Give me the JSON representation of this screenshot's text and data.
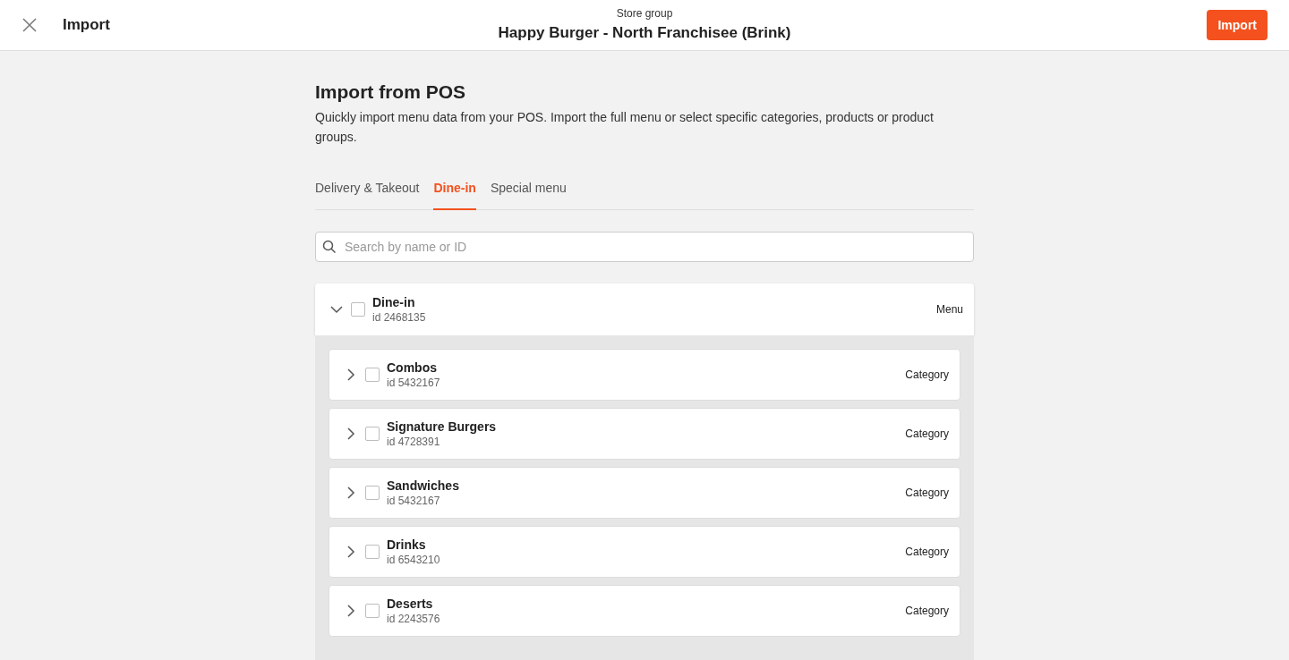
{
  "header": {
    "title": "Import",
    "subtitle": "Store group",
    "store": "Happy Burger - North Franchisee (Brink)",
    "import_button": "Import"
  },
  "page": {
    "title": "Import from POS",
    "description": "Quickly import menu data from your POS. Import the full menu or select specific categories, products or product groups."
  },
  "tabs": [
    {
      "label": "Delivery & Takeout",
      "selected": false
    },
    {
      "label": "Dine-in",
      "selected": true
    },
    {
      "label": "Special menu",
      "selected": false
    }
  ],
  "search": {
    "placeholder": "Search by name or ID"
  },
  "tree": [
    {
      "name": "Dine-in",
      "id": "id 2468135",
      "type": "Menu",
      "expanded": true,
      "checked": false,
      "children": [
        {
          "name": "Combos",
          "id": "id 5432167",
          "type": "Category",
          "expanded": false,
          "checked": false
        },
        {
          "name": "Signature Burgers",
          "id": "id 4728391",
          "type": "Category",
          "expanded": false,
          "checked": false
        },
        {
          "name": "Sandwiches",
          "id": "id 5432167",
          "type": "Category",
          "expanded": false,
          "checked": false
        },
        {
          "name": "Drinks",
          "id": "id 6543210",
          "type": "Category",
          "expanded": false,
          "checked": false
        },
        {
          "name": "Deserts",
          "id": "id 2243576",
          "type": "Category",
          "expanded": false,
          "checked": false
        }
      ]
    }
  ]
}
